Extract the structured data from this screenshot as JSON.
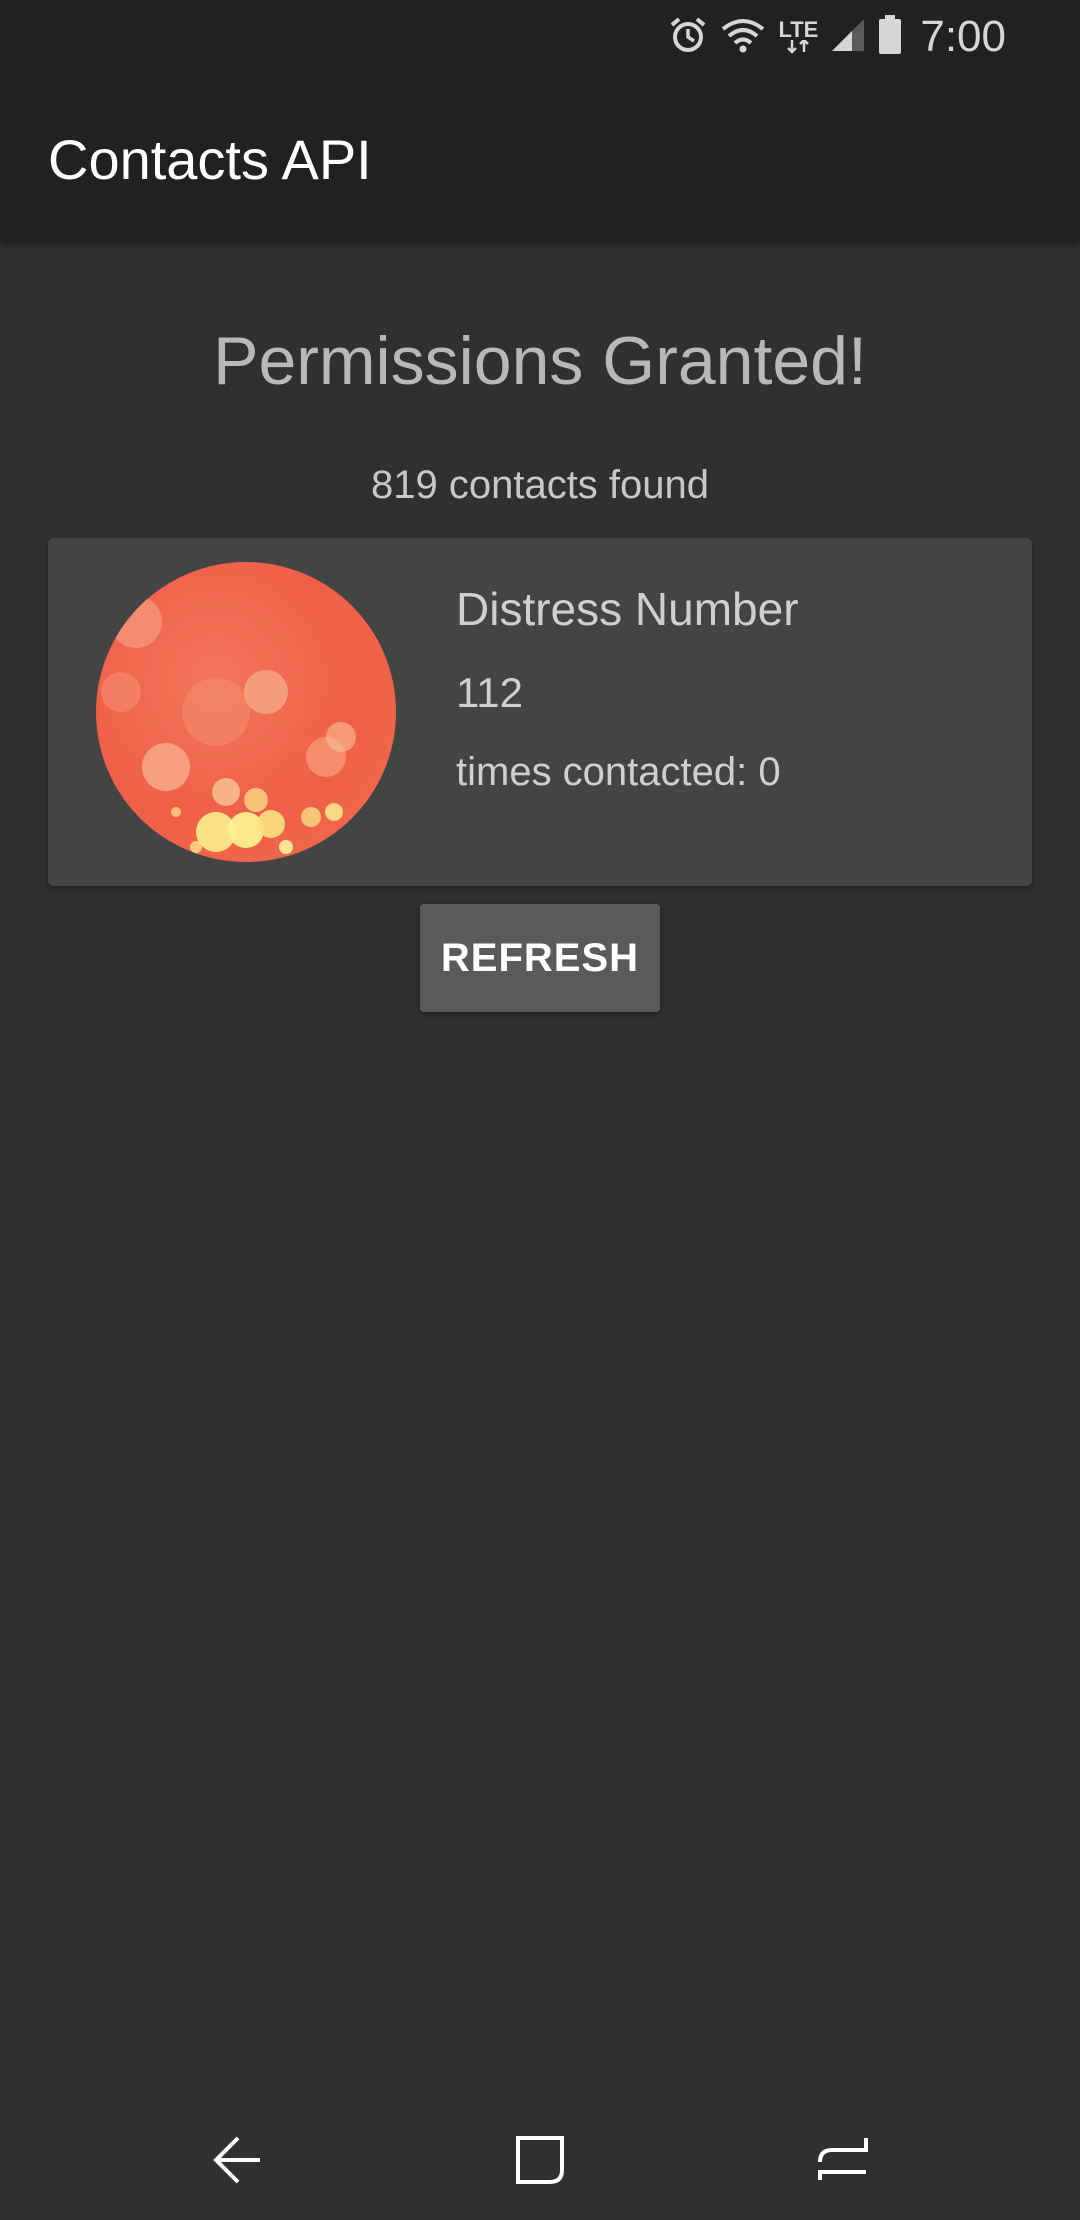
{
  "status_bar": {
    "time": "7:00",
    "network": "LTE",
    "icons": [
      "alarm-icon",
      "wifi-icon",
      "lte-icon",
      "signal-icon",
      "battery-icon"
    ]
  },
  "app_bar": {
    "title": "Contacts API"
  },
  "main": {
    "headline": "Permissions Granted!",
    "count_text": "819 contacts found"
  },
  "contact_card": {
    "name": "Distress Number",
    "number": "112",
    "times_contacted": "times contacted: 0",
    "avatar": "bokeh-photo-avatar"
  },
  "refresh_button": {
    "label": "REFRESH"
  },
  "nav_bar": {
    "icons": [
      "back-icon",
      "home-icon",
      "recents-icon"
    ]
  },
  "colors": {
    "background": "#303030",
    "app_bar": "#212121",
    "card": "#444444",
    "button": "#5a5a5c",
    "avatar_accent": "#ef5f48"
  }
}
